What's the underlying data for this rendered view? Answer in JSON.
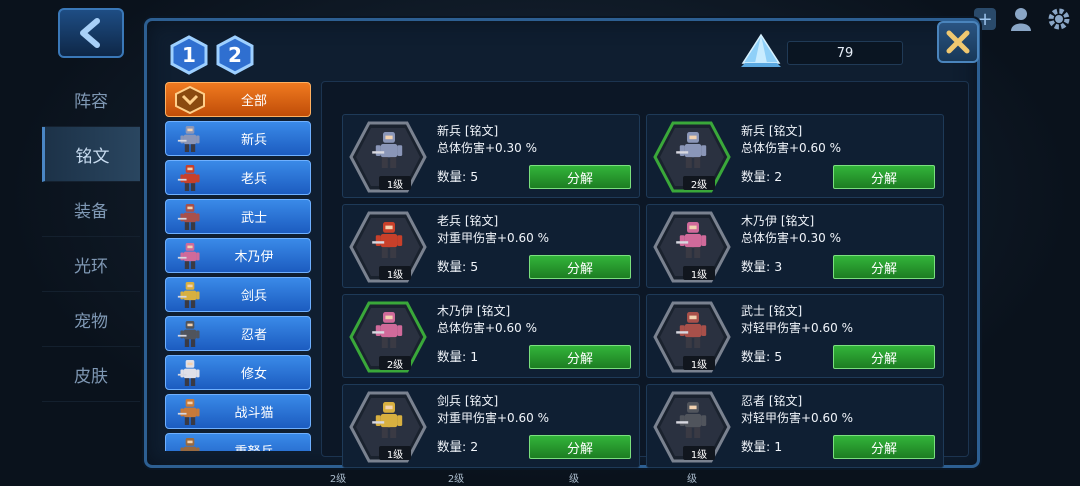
{
  "crystal_count": "79",
  "page_tabs": [
    "1",
    "2"
  ],
  "outer_menu": [
    {
      "label": "阵容",
      "active": false
    },
    {
      "label": "铭文",
      "active": true
    },
    {
      "label": "装备",
      "active": false
    },
    {
      "label": "光环",
      "active": false
    },
    {
      "label": "宠物",
      "active": false
    },
    {
      "label": "皮肤",
      "active": false
    }
  ],
  "categories": [
    {
      "label": "全部",
      "active": true,
      "icon": "all-filter-icon"
    },
    {
      "label": "新兵",
      "active": false,
      "icon": "recruit-portrait-icon"
    },
    {
      "label": "老兵",
      "active": false,
      "icon": "veteran-portrait-icon"
    },
    {
      "label": "武士",
      "active": false,
      "icon": "samurai-portrait-icon"
    },
    {
      "label": "木乃伊",
      "active": false,
      "icon": "mummy-portrait-icon"
    },
    {
      "label": "剑兵",
      "active": false,
      "icon": "swordsman-portrait-icon"
    },
    {
      "label": "忍者",
      "active": false,
      "icon": "ninja-portrait-icon"
    },
    {
      "label": "修女",
      "active": false,
      "icon": "nun-portrait-icon"
    },
    {
      "label": "战斗猫",
      "active": false,
      "icon": "battle-cat-portrait-icon"
    },
    {
      "label": "重弩兵",
      "active": false,
      "icon": "crossbow-portrait-icon"
    }
  ],
  "qty_prefix": "数量: ",
  "decompose_label": "分解",
  "cards": [
    {
      "name": "新兵 [铭文]",
      "effect": "总体伤害+0.30 %",
      "qty": "5",
      "level": "1级",
      "frame": "gray",
      "hero": "recruit",
      "color": "#8a96b8"
    },
    {
      "name": "新兵 [铭文]",
      "effect": "总体伤害+0.60 %",
      "qty": "2",
      "level": "2级",
      "frame": "green",
      "hero": "recruit",
      "color": "#8a96b8"
    },
    {
      "name": "老兵 [铭文]",
      "effect": "对重甲伤害+0.60 %",
      "qty": "5",
      "level": "1级",
      "frame": "gray",
      "hero": "veteran",
      "color": "#c8402a"
    },
    {
      "name": "木乃伊 [铭文]",
      "effect": "总体伤害+0.30 %",
      "qty": "3",
      "level": "1级",
      "frame": "gray",
      "hero": "mummy",
      "color": "#d06a9a"
    },
    {
      "name": "木乃伊 [铭文]",
      "effect": "总体伤害+0.60 %",
      "qty": "1",
      "level": "2级",
      "frame": "green",
      "hero": "mummy",
      "color": "#d06a9a"
    },
    {
      "name": "武士 [铭文]",
      "effect": "对轻甲伤害+0.60 %",
      "qty": "5",
      "level": "1级",
      "frame": "gray",
      "hero": "samurai",
      "color": "#a8504a"
    },
    {
      "name": "剑兵 [铭文]",
      "effect": "对重甲伤害+0.60 %",
      "qty": "2",
      "level": "1级",
      "frame": "gray",
      "hero": "swordsman",
      "color": "#d8b040"
    },
    {
      "name": "忍者 [铭文]",
      "effect": "对轻甲伤害+0.60 %",
      "qty": "1",
      "level": "1级",
      "frame": "gray",
      "hero": "ninja",
      "color": "#50545c"
    }
  ],
  "peek_levels": [
    "2级",
    "2级",
    "级",
    "级"
  ],
  "colors": {
    "frame_gray": "#7a8290",
    "frame_green": "#3aa83a",
    "button_green": "#2a9a2e",
    "category_blue": "#2a70d8",
    "category_orange": "#e06a14"
  }
}
